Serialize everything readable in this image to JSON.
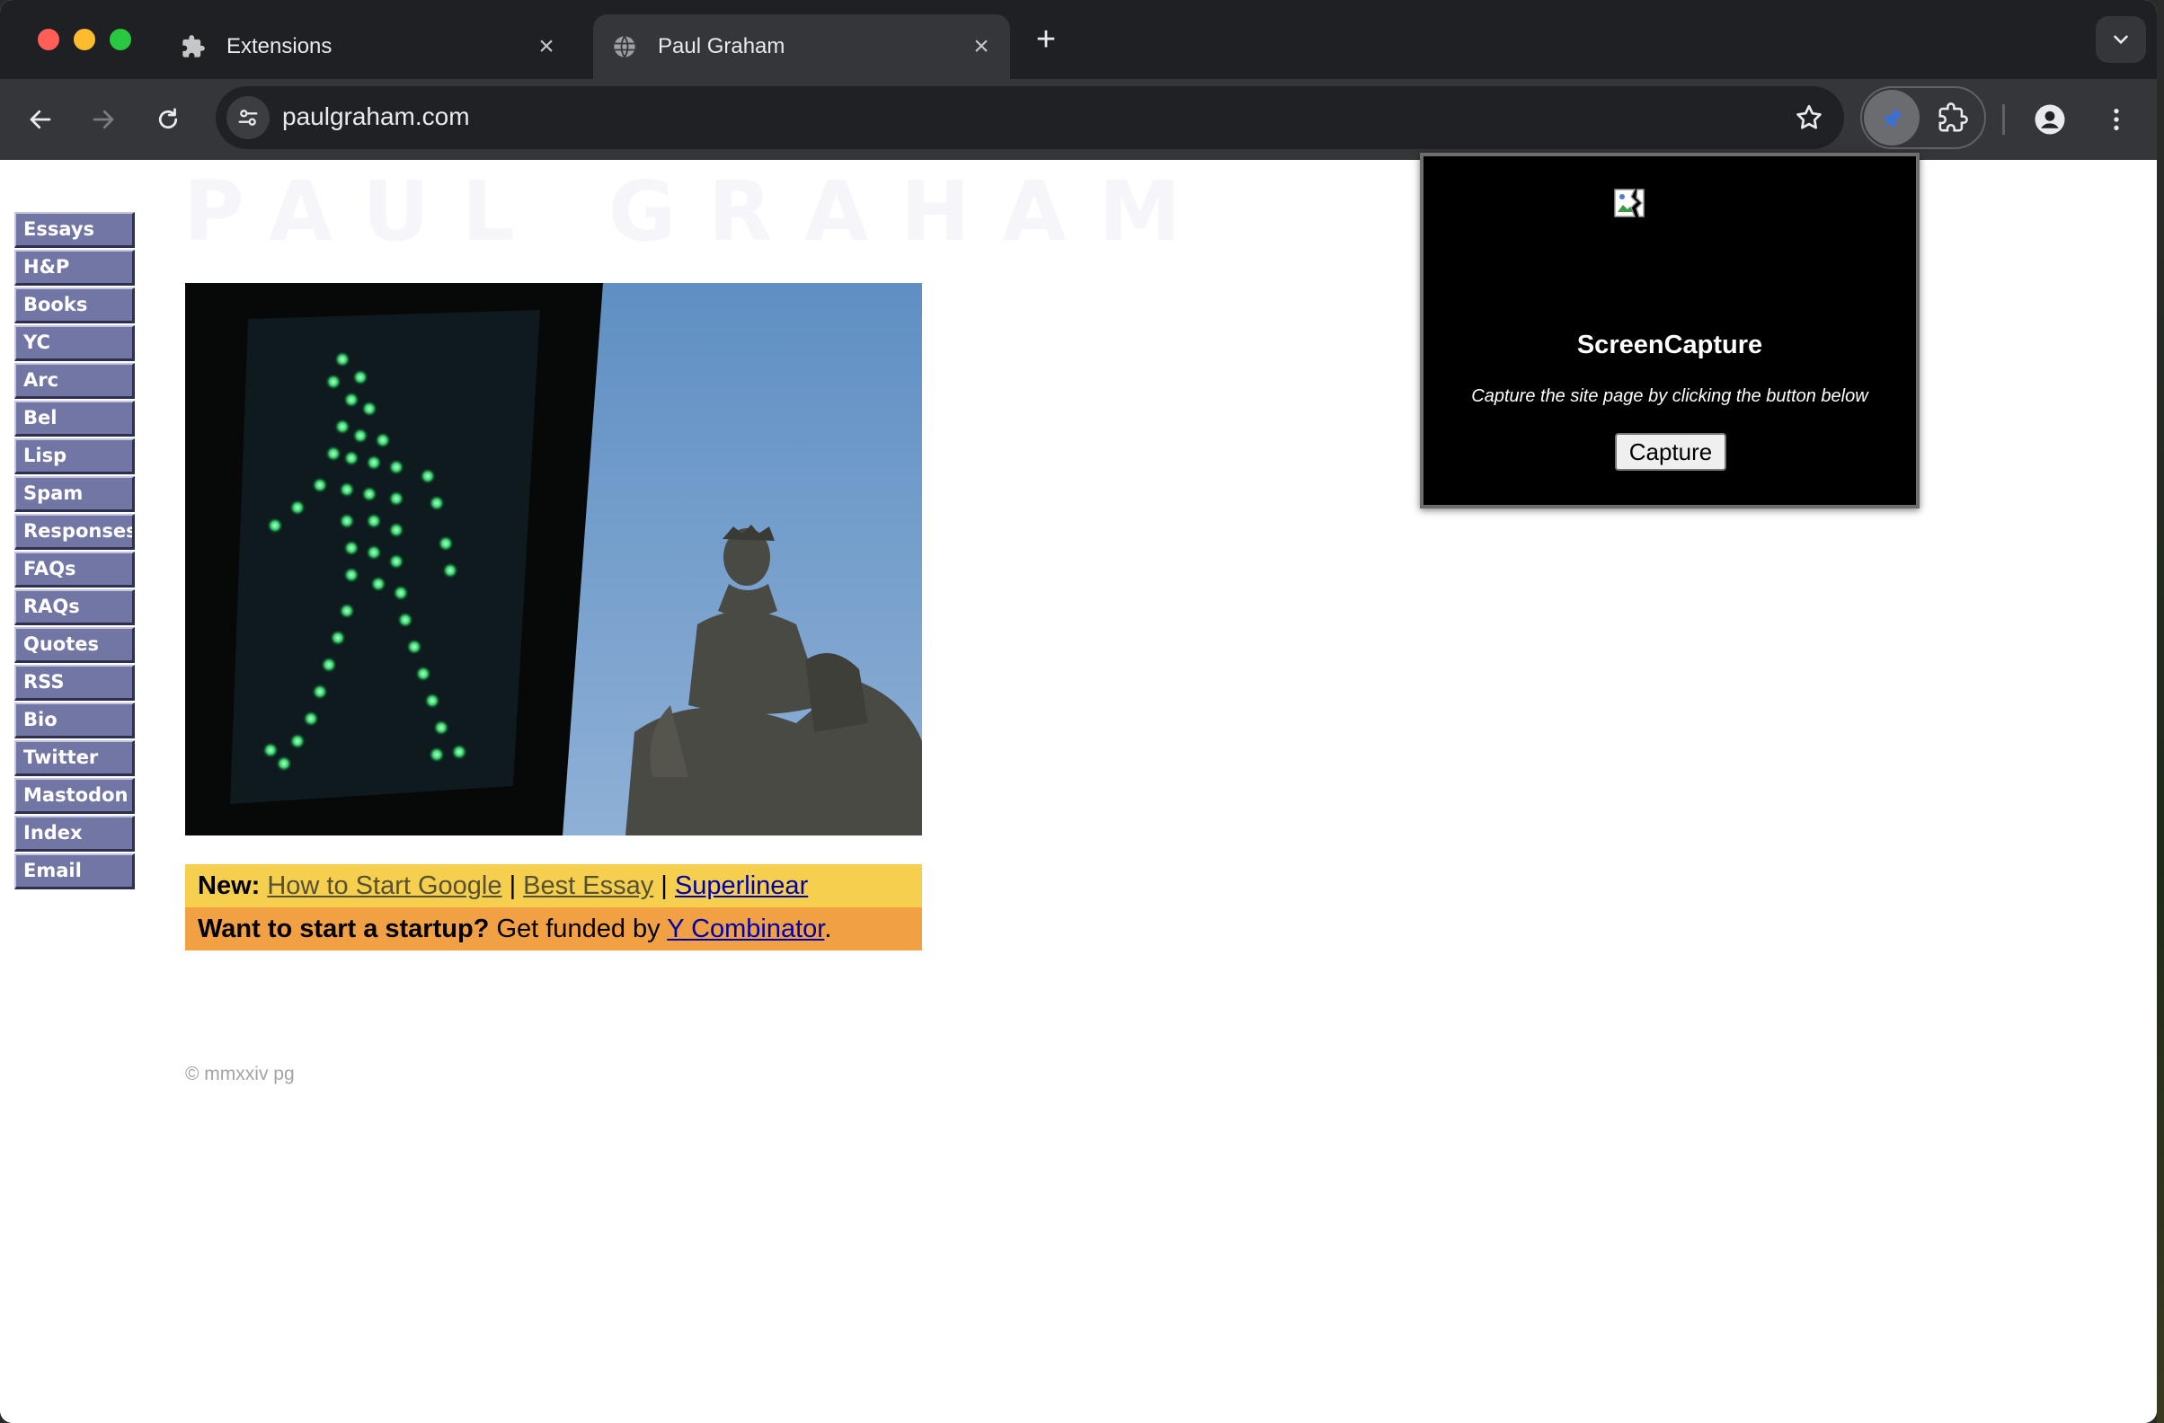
{
  "browser": {
    "tabs": [
      {
        "label": "Extensions",
        "icon": "puzzle-icon",
        "active": false
      },
      {
        "label": "Paul Graham",
        "icon": "globe-icon",
        "active": true
      }
    ],
    "close_glyph": "×",
    "new_tab_glyph": "+",
    "url": "paulgraham.com"
  },
  "site": {
    "logo_text": "PAUL GRAHAM",
    "nav": [
      "Essays",
      "H&P",
      "Books",
      "YC",
      "Arc",
      "Bel",
      "Lisp",
      "Spam",
      "Responses",
      "FAQs",
      "RAQs",
      "Quotes",
      "RSS",
      "Bio",
      "Twitter",
      "Mastodon",
      "Index",
      "Email"
    ],
    "news": {
      "label": "New:",
      "links": [
        "How to Start Google",
        "Best Essay",
        "Superlinear"
      ],
      "separator": "|"
    },
    "startup": {
      "label": "Want to start a startup?",
      "text": "Get funded by",
      "link": "Y Combinator",
      "end": "."
    },
    "copyright": "© mmxxiv pg"
  },
  "popup": {
    "title": "ScreenCapture",
    "description": "Capture the site page by clicking the button below",
    "button_label": "Capture"
  },
  "colors": {
    "nav_button": "#7276a4",
    "news_bar": "#f7cf4f",
    "startup_bar": "#f2a044",
    "extension_icon": "#3b6fd8"
  }
}
